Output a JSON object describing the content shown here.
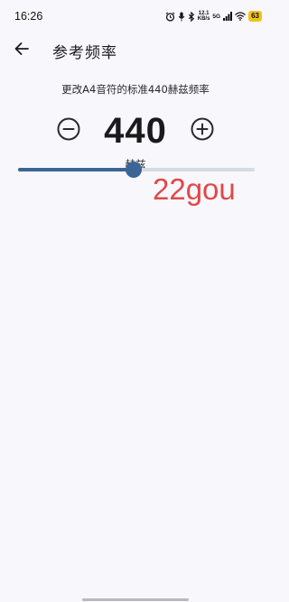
{
  "status_bar": {
    "time": "16:26",
    "net_speed_value": "12.1",
    "net_speed_unit": "KB/s",
    "network": "5G",
    "battery": "63",
    "icons": [
      "alarm-icon",
      "mic-icon",
      "bluetooth-icon",
      "wifi-icon",
      "signal-icon",
      "battery-icon"
    ]
  },
  "app_bar": {
    "title": "参考频率",
    "back_icon": "arrow-left-icon"
  },
  "content": {
    "description": "更改A4音符的标准440赫兹频率",
    "frequency": "440",
    "unit": "赫兹",
    "minus_icon": "minus-circle-icon",
    "plus_icon": "plus-circle-icon"
  },
  "slider": {
    "fraction": 0.49
  },
  "watermark": {
    "text": "22gou"
  },
  "colors": {
    "accent": "#3a6595",
    "background": "#f8f8fc",
    "watermark": "#e04848",
    "battery": "#f0c419"
  }
}
